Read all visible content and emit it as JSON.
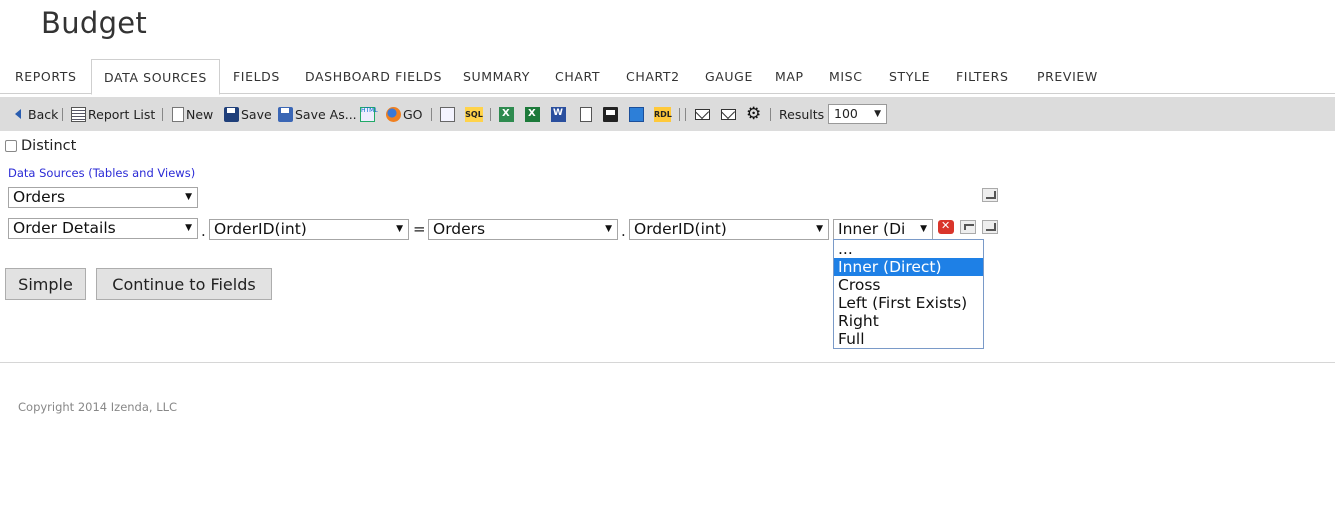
{
  "page": {
    "title": "Budget"
  },
  "tabs": [
    {
      "label": "REPORTS"
    },
    {
      "label": "DATA SOURCES",
      "active": true
    },
    {
      "label": "FIELDS"
    },
    {
      "label": "DASHBOARD FIELDS"
    },
    {
      "label": "SUMMARY"
    },
    {
      "label": "CHART"
    },
    {
      "label": "CHART2"
    },
    {
      "label": "GAUGE"
    },
    {
      "label": "MAP"
    },
    {
      "label": "MISC"
    },
    {
      "label": "STYLE"
    },
    {
      "label": "FILTERS"
    },
    {
      "label": "PREVIEW"
    }
  ],
  "toolbar": {
    "back": "Back",
    "report_list": "Report List",
    "new": "New",
    "save": "Save",
    "save_as": "Save As...",
    "html_badge": "HTML",
    "sql_badge": "SQL",
    "rdl_badge": "RDL",
    "go": "GO",
    "results_label": "Results",
    "results_value": "100"
  },
  "form": {
    "distinct_label": "Distinct",
    "distinct_checked": false,
    "section_label": "Data Sources (Tables and Views)",
    "primary_table": "Orders",
    "join": {
      "left_table": "Order Details",
      "left_field": "OrderID(int)",
      "operator": "=",
      "right_table": "Orders",
      "right_field": "OrderID(int)",
      "join_type_display": "Inner (Di",
      "join_options": [
        "...",
        "Inner (Direct)",
        "Cross",
        "Left (First Exists)",
        "Right",
        "Full"
      ],
      "selected_option_index": 1
    },
    "separator_dot": "."
  },
  "buttons": {
    "simple": "Simple",
    "continue": "Continue to Fields"
  },
  "footer": {
    "copyright": "Copyright 2014 Izenda, LLC"
  },
  "colors": {
    "link": "#2b2bd6",
    "toolbar_bg": "#dcdcdc",
    "selection": "#1e80e6"
  },
  "icons": {
    "arrow": "▼",
    "gear": "⚙"
  }
}
